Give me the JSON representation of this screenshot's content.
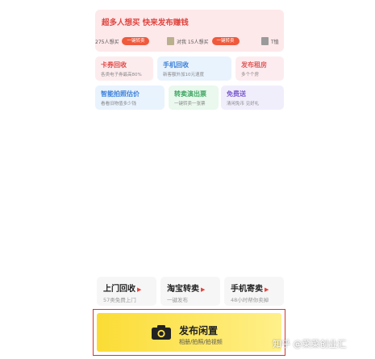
{
  "banner": {
    "title": "超多人想买 快来发布赚钱",
    "items": [
      {
        "text": "275人想买",
        "button": "一键转卖"
      },
      {
        "text": "对我 15人想买",
        "button": "一键转卖"
      },
      {
        "text": "T恤",
        "button": ""
      }
    ]
  },
  "cards": [
    {
      "title": "卡券回收",
      "subtitle": "各类电子券最高80%",
      "color": "red"
    },
    {
      "title": "手机回收",
      "subtitle": "新客额外加10元速度",
      "color": "blue"
    },
    {
      "title": "发布租房",
      "subtitle": "多个个房",
      "color": "pink"
    },
    {
      "title": "智能拍照估价",
      "subtitle": "看看旧物值多少钱",
      "color": "blue"
    },
    {
      "title": "转卖演出票",
      "subtitle": "一键转卖一张票",
      "color": "green"
    },
    {
      "title": "免费送",
      "subtitle": "清闲免币 见好礼",
      "color": "purple"
    }
  ],
  "services": [
    {
      "title": "上门回收",
      "subtitle": "57类免费上门"
    },
    {
      "title": "淘宝转卖",
      "subtitle": "一键发布"
    },
    {
      "title": "手机寄卖",
      "subtitle": "48小时帮你卖掉"
    }
  ],
  "publish": {
    "title": "发布闲置",
    "subtitle": "相册/拍照/拍视频",
    "icon": "camera-icon"
  },
  "watermark": "知乎 @菜菜创业汇"
}
